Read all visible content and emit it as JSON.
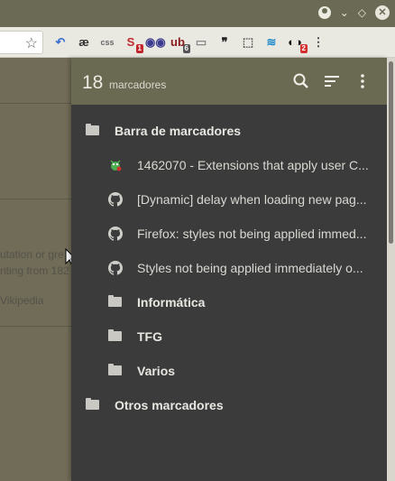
{
  "browser": {
    "window_controls": {
      "account": "account-icon",
      "chevron": "⌄",
      "restore": "◇",
      "close": "✕"
    },
    "toolbar": {
      "bookmark_star": "☆",
      "extensions": [
        {
          "name": "undo-arrow-icon",
          "glyph": "↶",
          "color": "#3a6fd1",
          "badge": ""
        },
        {
          "name": "ae-icon",
          "glyph": "æ",
          "color": "#333333",
          "badge": ""
        },
        {
          "name": "css-icon",
          "glyph": "css",
          "color": "#666666",
          "badge": ""
        },
        {
          "name": "s-red-icon",
          "glyph": "S",
          "color": "#c1272d",
          "badge": "1",
          "badge_color": "#c1272d"
        },
        {
          "name": "owl-icon",
          "glyph": "◉◉",
          "color": "#3b3b8f",
          "badge": ""
        },
        {
          "name": "ublock-icon",
          "glyph": "ub",
          "color": "#8b1a1a",
          "badge": "6",
          "badge_color": "#555555"
        },
        {
          "name": "page-icon",
          "glyph": "▭",
          "color": "#888888",
          "badge": ""
        },
        {
          "name": "quote-icon",
          "glyph": "❞",
          "color": "#222222",
          "badge": ""
        },
        {
          "name": "bookmark-outline-icon",
          "glyph": "⬚",
          "color": "#555555",
          "badge": ""
        },
        {
          "name": "wave-icon",
          "glyph": "≋",
          "color": "#1e88c8",
          "badge": ""
        },
        {
          "name": "eyes-icon",
          "glyph": "◐◑",
          "color": "#111111",
          "badge": "2",
          "badge_color": "#d32f2f"
        },
        {
          "name": "kebab-menu-icon",
          "glyph": "⋮",
          "color": "#444444",
          "badge": ""
        }
      ]
    }
  },
  "page_behind": {
    "snippets": [
      "utation or gre",
      "riting from 182",
      "Vikipedia"
    ]
  },
  "panel": {
    "count": "18",
    "count_label": "marcadores",
    "items": [
      {
        "kind": "folder",
        "depth": 0,
        "label": "Barra de marcadores"
      },
      {
        "kind": "link",
        "depth": 1,
        "label": "1462070 - Extensions that apply user C...",
        "icon": "bugzilla-icon"
      },
      {
        "kind": "link",
        "depth": 1,
        "label": "[Dynamic] delay when loading new pag...",
        "icon": "github-icon"
      },
      {
        "kind": "link",
        "depth": 1,
        "label": "Firefox: styles not being applied immed...",
        "icon": "github-icon"
      },
      {
        "kind": "link",
        "depth": 1,
        "label": "Styles not being applied immediately o...",
        "icon": "github-icon"
      },
      {
        "kind": "folder",
        "depth": 1,
        "label": "Informática"
      },
      {
        "kind": "folder",
        "depth": 1,
        "label": "TFG"
      },
      {
        "kind": "folder",
        "depth": 1,
        "label": "Varios"
      },
      {
        "kind": "folder",
        "depth": 0,
        "label": "Otros marcadores"
      }
    ]
  }
}
